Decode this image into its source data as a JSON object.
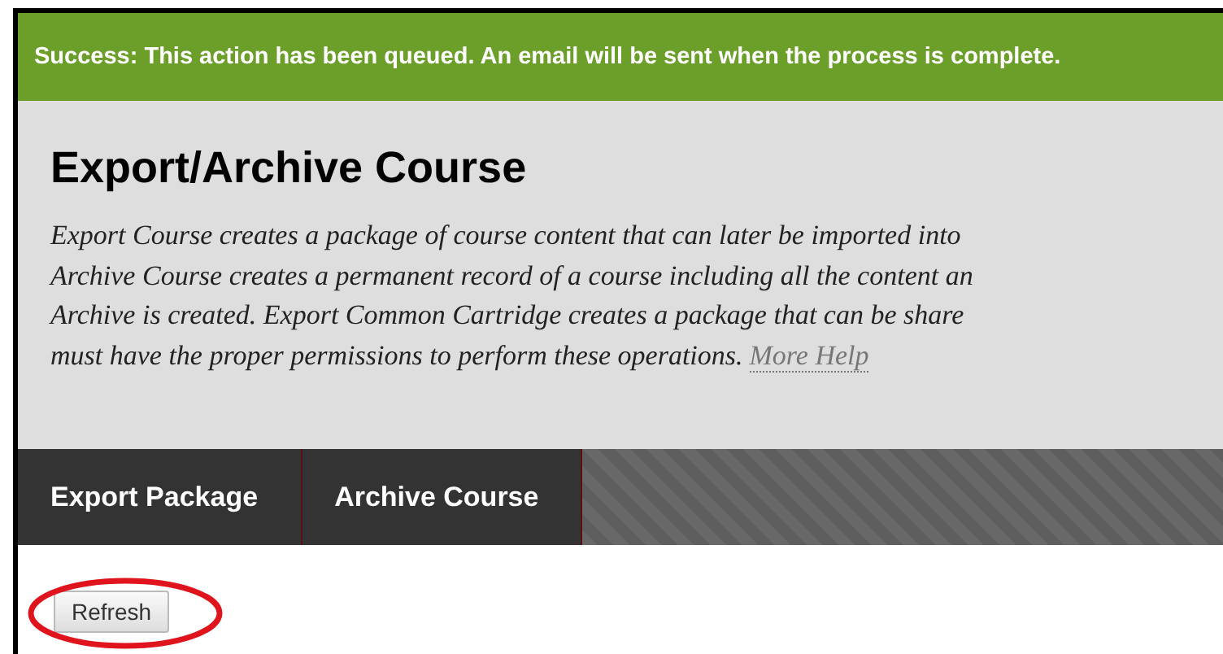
{
  "banner": {
    "text": "Success: This action has been queued. An email will be sent when the process is complete."
  },
  "page": {
    "title": "Export/Archive Course",
    "description_lines": [
      "Export Course creates a package of course content that can later be imported into",
      "Archive Course creates a permanent record of a course including all the content an",
      "Archive is created. Export Common Cartridge creates a package that can be share",
      "must have the proper permissions to perform these operations."
    ],
    "more_help": "More Help"
  },
  "tabs": [
    {
      "label": "Export Package",
      "selected": false
    },
    {
      "label": "Archive Course",
      "selected": false
    }
  ],
  "refresh_button": {
    "label": "Refresh",
    "highlighted": true
  }
}
